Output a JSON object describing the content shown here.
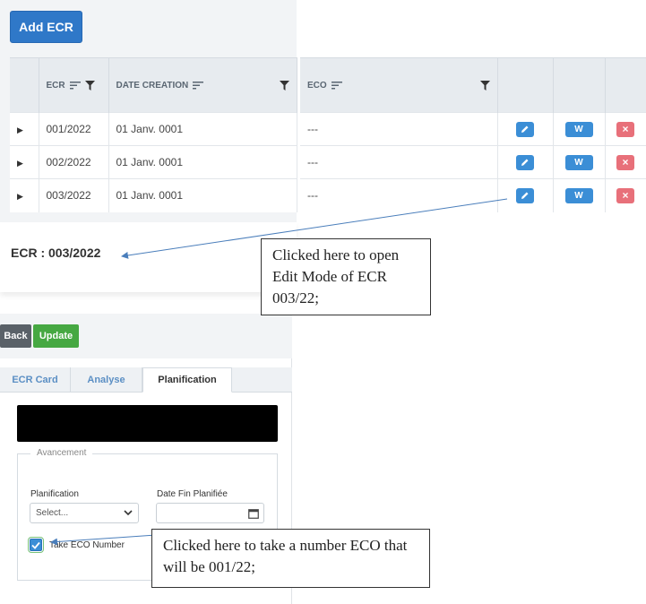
{
  "toolbar": {
    "add_label": "Add ECR"
  },
  "grid": {
    "columns": {
      "ecr": "ECR",
      "date_creation": "DATE CREATION",
      "eco": "ECO"
    },
    "rows": [
      {
        "ecr": "001/2022",
        "date": "01 Janv. 0001",
        "eco": "---"
      },
      {
        "ecr": "002/2022",
        "date": "01 Janv. 0001",
        "eco": "---"
      },
      {
        "ecr": "003/2022",
        "date": "01 Janv. 0001",
        "eco": "---"
      }
    ],
    "action_w_label": "W",
    "action_delete_glyph": "×"
  },
  "ecr_title": "ECR : 003/2022",
  "annotations": {
    "callout1": "Clicked here to open Edit Mode of ECR 003/22;",
    "callout2": "Clicked here to take a number ECO that will be 001/22;"
  },
  "edit": {
    "back_label": "Back",
    "update_label": "Update",
    "tabs": [
      "ECR Card",
      "Analyse",
      "Planification"
    ],
    "active_tab": "Planification",
    "fieldset_legend": "Avancement",
    "planification_label": "Planification",
    "planification_value": "Select...",
    "date_fin_label": "Date Fin Planifiée",
    "take_eco_label": "Take ECO Number",
    "take_eco_checked": true
  },
  "colors": {
    "primary": "#2f78c8",
    "action_blue": "#3b8ed6",
    "delete_red": "#e8707a",
    "update_green": "#46a842",
    "back_gray": "#5a6168"
  }
}
